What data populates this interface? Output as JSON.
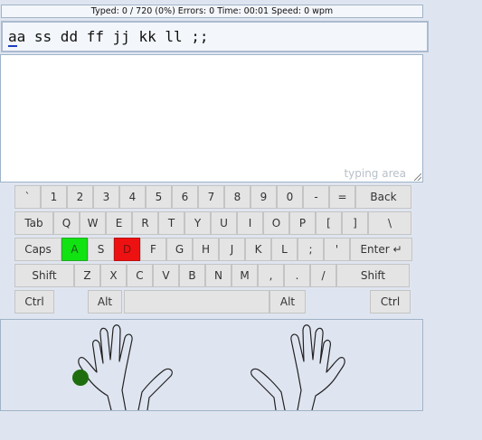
{
  "status": {
    "text": "Typed: 0 / 720 (0%) Errors: 0 Time: 00:01 Speed: 0 wpm"
  },
  "lesson": {
    "current_char": "a",
    "rest": "a ss dd ff jj kk ll ;;"
  },
  "typing_area": {
    "placeholder": "typing area"
  },
  "keyboard": {
    "row1": [
      "`",
      "1",
      "2",
      "3",
      "4",
      "5",
      "6",
      "7",
      "8",
      "9",
      "0",
      "-",
      "=",
      "Back"
    ],
    "row2": [
      "Tab",
      "Q",
      "W",
      "E",
      "R",
      "T",
      "Y",
      "U",
      "I",
      "O",
      "P",
      "[",
      "]",
      "\\"
    ],
    "row3": [
      "Caps",
      "A",
      "S",
      "D",
      "F",
      "G",
      "H",
      "J",
      "K",
      "L",
      ";",
      "'",
      "Enter ↵"
    ],
    "row4": [
      "Shift",
      "Z",
      "X",
      "C",
      "V",
      "B",
      "N",
      "M",
      ",",
      ".",
      "/",
      "Shift"
    ],
    "row5": [
      "Ctrl",
      "Alt",
      "",
      "Alt",
      "Ctrl"
    ],
    "highlight_correct": "A",
    "highlight_error": "D",
    "colors": {
      "correct": "#11e211",
      "error": "#ee1111"
    }
  },
  "hands": {
    "active_finger": "left-pinky",
    "indicator_color": "#1e6e0e"
  }
}
